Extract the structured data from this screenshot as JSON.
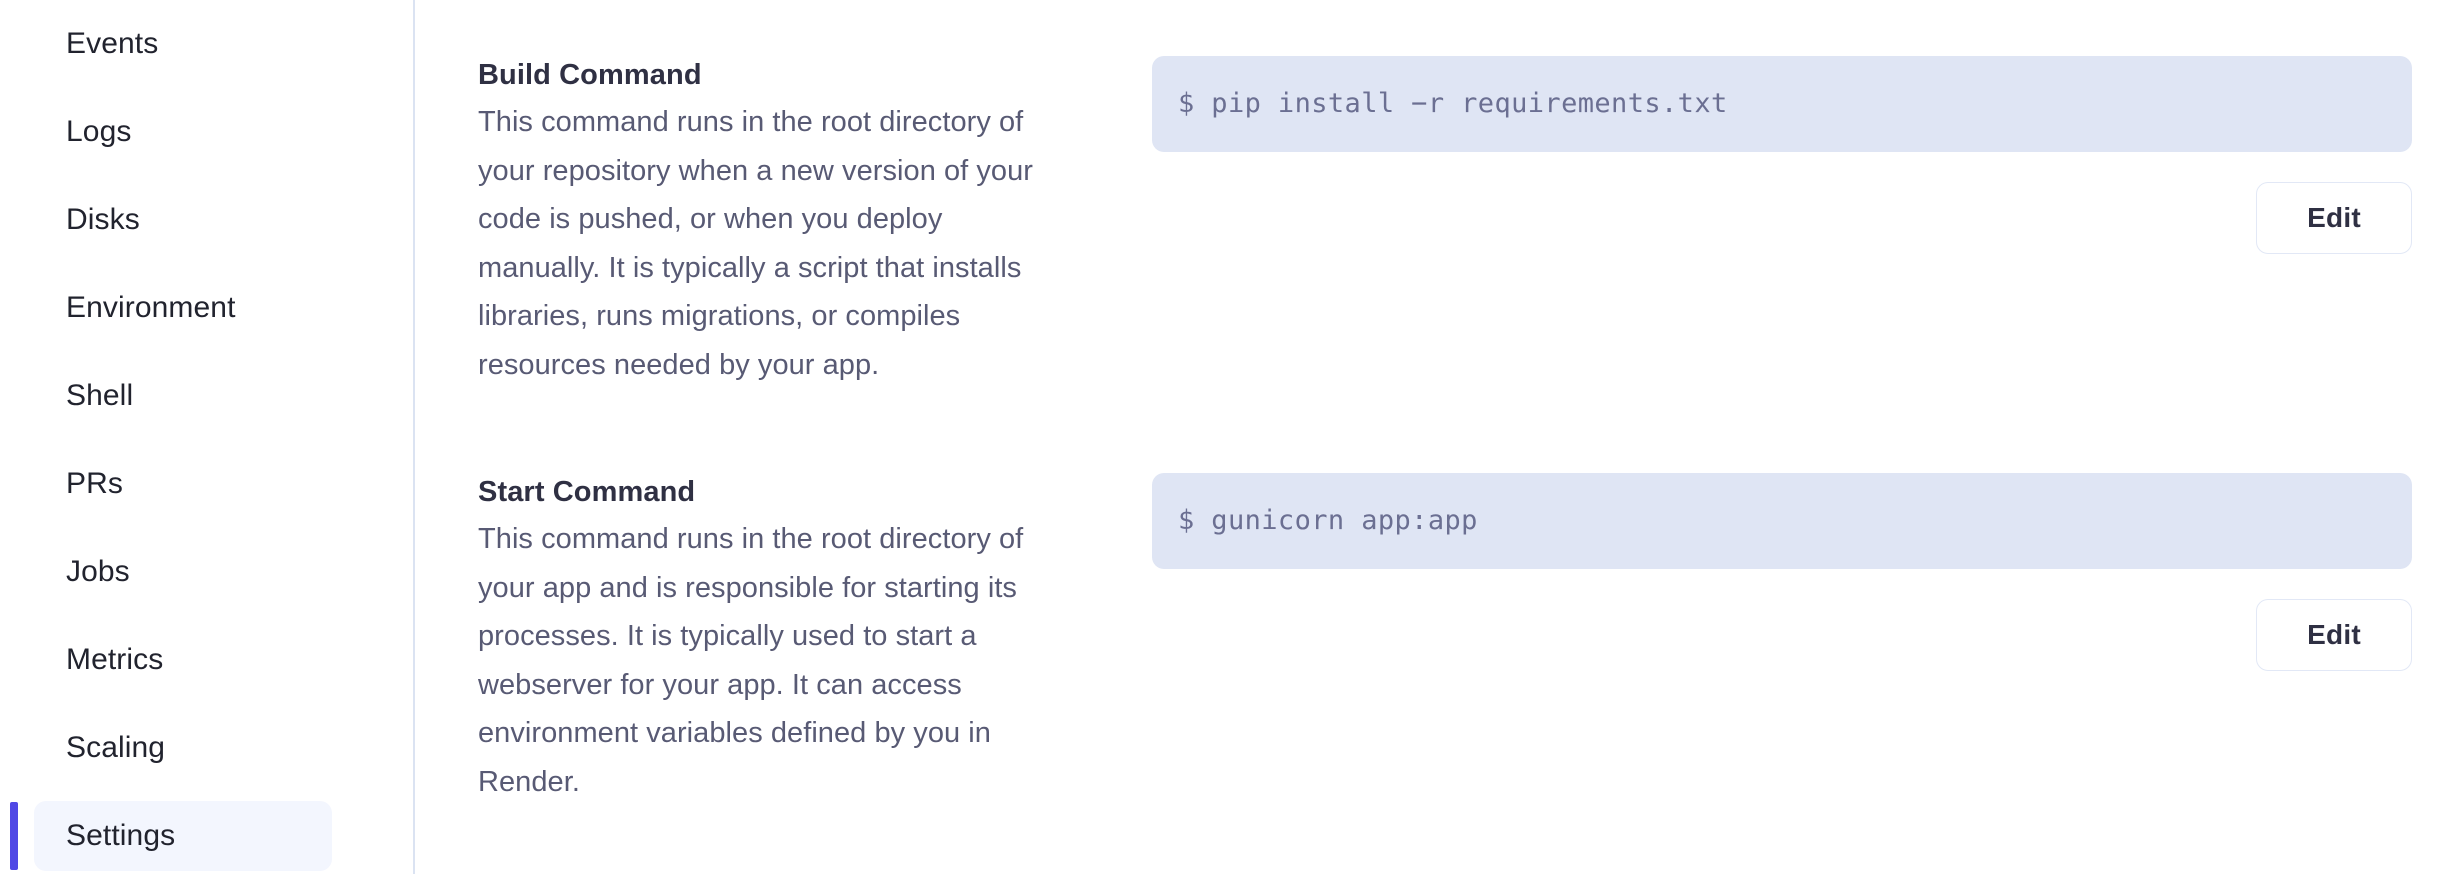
{
  "sidebar": {
    "items": [
      {
        "label": "Events",
        "active": false
      },
      {
        "label": "Logs",
        "active": false
      },
      {
        "label": "Disks",
        "active": false
      },
      {
        "label": "Environment",
        "active": false
      },
      {
        "label": "Shell",
        "active": false
      },
      {
        "label": "PRs",
        "active": false
      },
      {
        "label": "Jobs",
        "active": false
      },
      {
        "label": "Metrics",
        "active": false
      },
      {
        "label": "Scaling",
        "active": false
      },
      {
        "label": "Settings",
        "active": true
      }
    ]
  },
  "settings": {
    "build_command": {
      "title": "Build Command",
      "description": "This command runs in the root directory of your repository when a new version of your code is pushed, or when you deploy manually. It is typically a script that installs libraries, runs migrations, or compiles resources needed by your app.",
      "value": "$ pip install −r requirements.txt",
      "edit_label": "Edit"
    },
    "start_command": {
      "title": "Start Command",
      "description": "This command runs in the root directory of your app and is responsible for starting its processes. It is typically used to start a webserver for your app. It can access environment variables defined by you in Render.",
      "value": "$ gunicorn app:app",
      "edit_label": "Edit"
    }
  },
  "colors": {
    "accent": "#5048e5",
    "active_pill_bg": "#f3f6fe",
    "code_bg": "#dfe5f4",
    "code_text": "#6b6f92",
    "heading_text": "#2f3043",
    "body_text": "#585a74",
    "divider": "#dbe3f2",
    "button_border": "#e2e8f6"
  }
}
